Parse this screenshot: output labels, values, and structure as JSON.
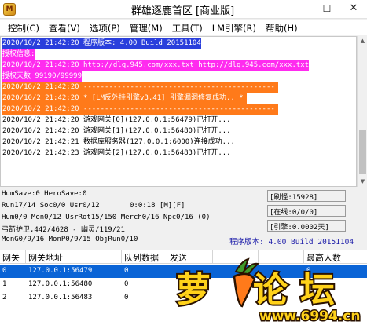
{
  "window": {
    "title": "群雄逐鹿首区 [商业版]",
    "app_icon_text": "M",
    "minimize_label": "—",
    "maximize_label": "☐",
    "close_label": "✕"
  },
  "menu": [
    {
      "label": "控制(C)"
    },
    {
      "label": "查看(V)"
    },
    {
      "label": "选项(P)"
    },
    {
      "label": "管理(M)"
    },
    {
      "label": "工具(T)"
    },
    {
      "label": "LM引擎(R)"
    },
    {
      "label": "帮助(H)"
    }
  ],
  "log": [
    {
      "text": "2020/10/2 21:42:20 程序版本: 4.00 Build 20151104",
      "style": "bg-blue"
    },
    {
      "text": "授权信息:",
      "style": "bg-magenta"
    },
    {
      "text": "2020/10/2 21:42:20 http://dlq.945.com/xxx.txt http://dlq.945.com/xxx.txt",
      "style": "bg-magenta"
    },
    {
      "text": "授权天数 99190/99999",
      "style": "bg-magenta"
    },
    {
      "text": "2020/10/2 21:42:20 ---------------------------------------------",
      "style": "bg-orange"
    },
    {
      "text": "2020/10/2 21:42:20 * [LM反外挂引擎v3.41] 引擎漏洞修复成功.. *",
      "style": "bg-orange"
    },
    {
      "text": "2020/10/2 21:42:20 ---------------------------------------------",
      "style": "bg-orange"
    },
    {
      "text": "2020/10/2 21:42:20 游戏网关[0](127.0.0.1:56479)已打开...",
      "style": "fg-black"
    },
    {
      "text": "2020/10/2 21:42:20 游戏网关[1](127.0.0.1:56480)已打开...",
      "style": "fg-black"
    },
    {
      "text": "2020/10/2 21:42:21 数据库服务器(127.0.0.1:6000)连接成功...",
      "style": "fg-black"
    },
    {
      "text": "2020/10/2 21:42:23 游戏网关[2](127.0.0.1:56483)已打开...",
      "style": "fg-black"
    }
  ],
  "status": {
    "line1": "HumSave:0 HeroSave:0",
    "line2": "Run17/14 Soc0/0 Usr0/12",
    "time": "0:0:18 [M][F]",
    "line3": "Hum0/0 Mon0/12 UsrRot15/150 Merch0/16 Npc0/16 (0)",
    "line4": "弓箭护卫,442/4628 - 幽灵/119/21",
    "line5": "MonG0/9/16 MonP0/9/15 ObjRun0/10",
    "refresh": "[刷怪:15928]",
    "online": "[在线:0/0/0]",
    "engine": "[引擎:0.0002天]",
    "version": "程序版本: 4.00 Build 20151104"
  },
  "table": {
    "headers": [
      "网关",
      "网关地址",
      "队列数据",
      "发送",
      "",
      "",
      "最高人数"
    ],
    "rows": [
      [
        "0",
        "127.0.0.1:56479",
        "0",
        "",
        "",
        "",
        "0"
      ],
      [
        "1",
        "127.0.0.1:56480",
        "0",
        "",
        "",
        "",
        "0"
      ],
      [
        "2",
        "127.0.0.1:56483",
        "0",
        "",
        "",
        "",
        "0"
      ]
    ],
    "selected_row": 0
  },
  "watermark": {
    "title": "萝卜论坛",
    "url": "www.6994.cn",
    "colors": {
      "text": "#ffd21a",
      "outline": "#2a1200",
      "carrot": "#ff7a1a",
      "leaf": "#3f9a2a"
    }
  }
}
